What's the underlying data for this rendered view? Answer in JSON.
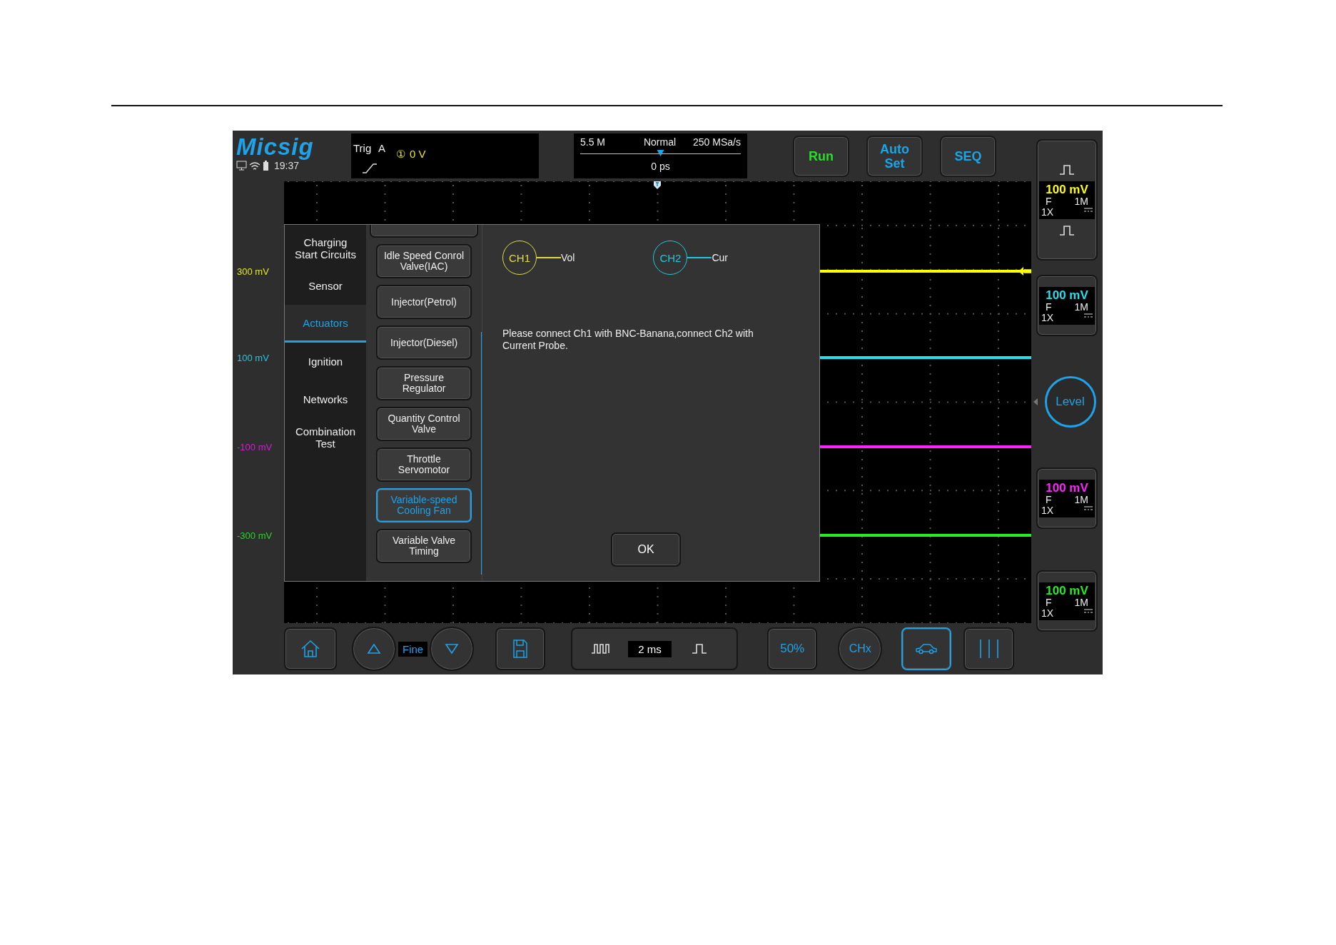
{
  "status": {
    "logo": "Micsig",
    "time": "19:37"
  },
  "trigger": {
    "label": "Trig",
    "source": "A",
    "channel": "①",
    "level_value": "0 V"
  },
  "timebase": {
    "memory": "5.5 M",
    "mode": "Normal",
    "sample_rate": "250 MSa/s",
    "offset": "0 ps",
    "level": 0.5
  },
  "top_buttons": [
    {
      "label": "Run",
      "color": "#2bdc2b"
    },
    {
      "label": "Auto Set",
      "color": "#1aa6e6"
    },
    {
      "label": "SEQ",
      "color": "#1aa6e6"
    }
  ],
  "scale_labels": [
    {
      "text": "300 mV",
      "color": "#e6e630"
    },
    {
      "text": "100 mV",
      "color": "#22c8e0"
    },
    {
      "text": "-100 mV",
      "color": "#d020d0"
    },
    {
      "text": "-300 mV",
      "color": "#30d030"
    }
  ],
  "channels": [
    {
      "scale": "100 mV",
      "coupling": "F",
      "impedance": "1M",
      "probe": "1X",
      "color": "#ffff00"
    },
    {
      "scale": "100 mV",
      "coupling": "F",
      "impedance": "1M",
      "probe": "1X",
      "color": "#22e0f0"
    },
    {
      "scale": "100 mV",
      "coupling": "F",
      "impedance": "1M",
      "probe": "1X",
      "color": "#ff22ff"
    },
    {
      "scale": "100 mV",
      "coupling": "F",
      "impedance": "1M",
      "probe": "1X",
      "color": "#22ee22"
    }
  ],
  "level_button": "Level",
  "dialog": {
    "categories": [
      {
        "label": "Charging Start Circuits",
        "selected": false
      },
      {
        "label": "Sensor",
        "selected": false
      },
      {
        "label": "Actuators",
        "selected": true
      },
      {
        "label": "Ignition",
        "selected": false
      },
      {
        "label": "Networks",
        "selected": false
      },
      {
        "label": "Combination Test",
        "selected": false
      }
    ],
    "tests": [
      {
        "label": "Idle Speed Conrol Valve(IAC)",
        "selected": false
      },
      {
        "label": "Injector(Petrol)",
        "selected": false
      },
      {
        "label": "Injector(Diesel)",
        "selected": false
      },
      {
        "label": "Pressure Regulator",
        "selected": false
      },
      {
        "label": "Quantity Control Valve",
        "selected": false
      },
      {
        "label": "Throttle Servomotor",
        "selected": false
      },
      {
        "label": "Variable-speed Cooling Fan",
        "selected": true
      },
      {
        "label": "Variable Valve Timing",
        "selected": false
      }
    ],
    "connections": [
      {
        "channel": "CH1",
        "signal": "Vol",
        "color": "#e0dc40"
      },
      {
        "channel": "CH2",
        "signal": "Cur",
        "color": "#1ec8e0"
      }
    ],
    "message": "Please connect Ch1 with BNC-Banana,connect Ch2 with Current Probe.",
    "ok": "OK"
  },
  "bottom_bar": {
    "fine": "Fine",
    "timebase": "2 ms",
    "trigger_50": "50%",
    "channel_select": "CHx",
    "car_selected": true
  }
}
